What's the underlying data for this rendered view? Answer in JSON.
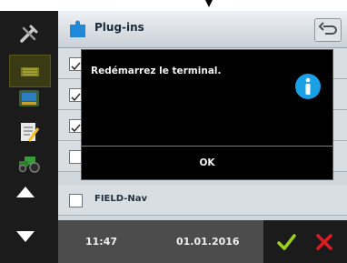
{
  "header": {
    "title": "Plug-ins"
  },
  "list": {
    "rows": [
      {
        "label": "",
        "checked": true
      },
      {
        "label": "",
        "checked": true
      },
      {
        "label": "",
        "checked": true
      },
      {
        "label": "",
        "checked": false
      },
      {
        "label": "FIELD-Nav",
        "checked": false
      }
    ]
  },
  "dialog": {
    "message": "Redémarrez le terminal.",
    "ok_label": "OK",
    "icon": "info-icon"
  },
  "status": {
    "time": "11:47",
    "date": "01.01.2016"
  },
  "colors": {
    "accept": "#9bd11b",
    "cancel": "#e01a22",
    "info": "#1aa0e6"
  }
}
